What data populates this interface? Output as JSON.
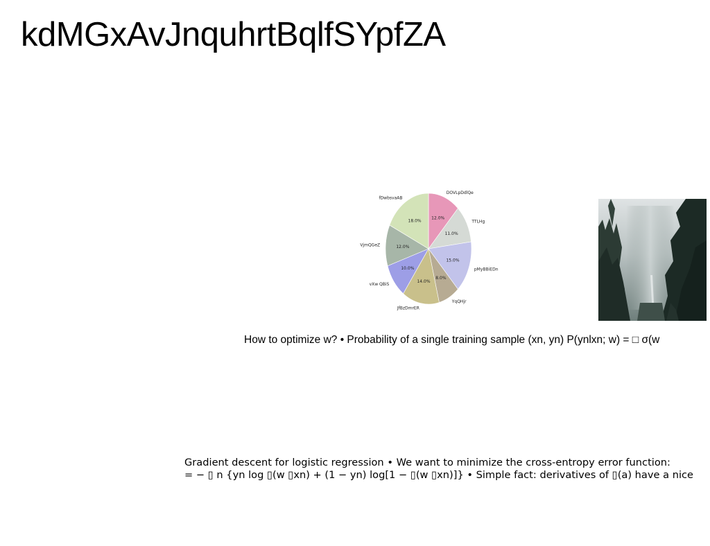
{
  "title": "kdMGxAvJnquhrtBqlfSYpfZA",
  "chart_data": {
    "type": "pie",
    "slices": [
      {
        "label": "DOVLpDdlQe",
        "value": 12.0,
        "pct": "12.0%",
        "color": "#e797b8"
      },
      {
        "label": "TTLHg",
        "value": 11.0,
        "pct": "11.0%",
        "color": "#d5dad5"
      },
      {
        "label": "pMyBBiEDn",
        "value": 15.0,
        "pct": "15.0%",
        "color": "#c2c3ea"
      },
      {
        "label": "YqQHjr",
        "value": 8.0,
        "pct": "8.0%",
        "color": "#b7ab93"
      },
      {
        "label": "JfBzDmrER",
        "value": 14.0,
        "pct": "14.0%",
        "color": "#c9c08b"
      },
      {
        "label": "vXw QBiS",
        "value": 10.0,
        "pct": "10.0%",
        "color": "#9d9ee6"
      },
      {
        "label": "VjmQGeZ",
        "value": 12.0,
        "pct": "12.0%",
        "color": "#a7b6a8"
      },
      {
        "label": "fDwbsvaAB",
        "value": 18.0,
        "pct": "18.0%",
        "color": "#d3e3b8"
      }
    ]
  },
  "caption1": "How to optimize w? • Probability of a single training sample (xn, yn) P(ynlxn; w) = □ σ(w",
  "caption2": {
    "line1": "Gradient descent for logistic regression • We want to minimize the cross-entropy error function:",
    "line2": "= − ▯ n {yn log ▯(w ▯xn) + (1 − yn) log[1 − ▯(w ▯xn)]} • Simple fact: derivatives of ▯(a) have a nice"
  }
}
